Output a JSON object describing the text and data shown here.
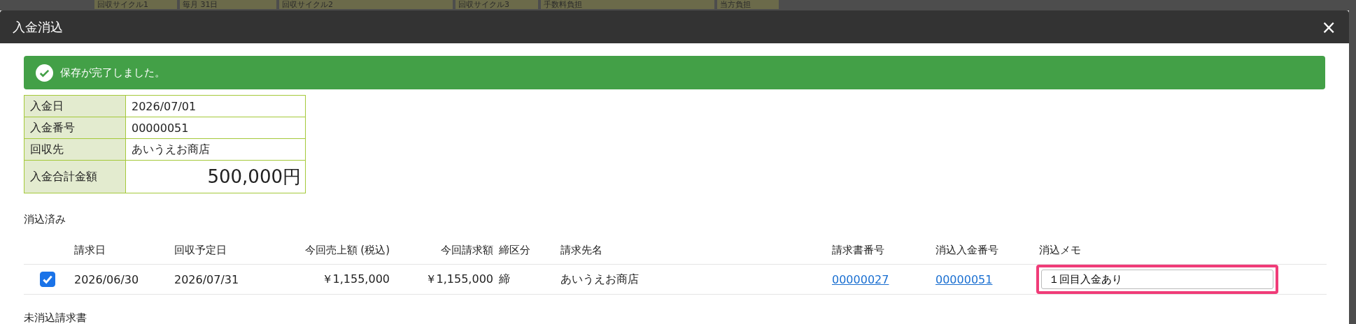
{
  "backdrop": {
    "cells": [
      "回収サイクル1",
      "毎月 31日",
      "回収サイクル2",
      "回収サイクル3",
      "手数料負担",
      "当方負担"
    ]
  },
  "modal": {
    "title": "入金消込",
    "close": "×"
  },
  "alert": {
    "message": "保存が完了しました。"
  },
  "summary": [
    {
      "label": "入金日",
      "value": "2026/07/01",
      "kind": "plain"
    },
    {
      "label": "入金番号",
      "value": "00000051",
      "kind": "plain"
    },
    {
      "label": "回収先",
      "value": "あいうえお商店",
      "kind": "plain"
    },
    {
      "label": "入金合計金額",
      "value": "500,000円",
      "kind": "total"
    }
  ],
  "cleared": {
    "title": "消込済み",
    "columns": [
      "請求日",
      "回収予定日",
      "今回売上額 (税込)",
      "今回請求額",
      "締区分",
      "請求先名",
      "請求書番号",
      "消込入金番号",
      "消込メモ"
    ],
    "rows": [
      {
        "checked": true,
        "invoice_date": "2026/06/30",
        "due_date": "2026/07/31",
        "sales": "￥1,155,000",
        "billed": "￥1,155,000",
        "closing": "締",
        "customer": "あいうえお商店",
        "invoice_no": "00000027",
        "payment_no": "00000051",
        "memo": "１回目入金あり",
        "memo_highlighted": true
      }
    ]
  },
  "uncleared": {
    "title": "未消込請求書"
  }
}
